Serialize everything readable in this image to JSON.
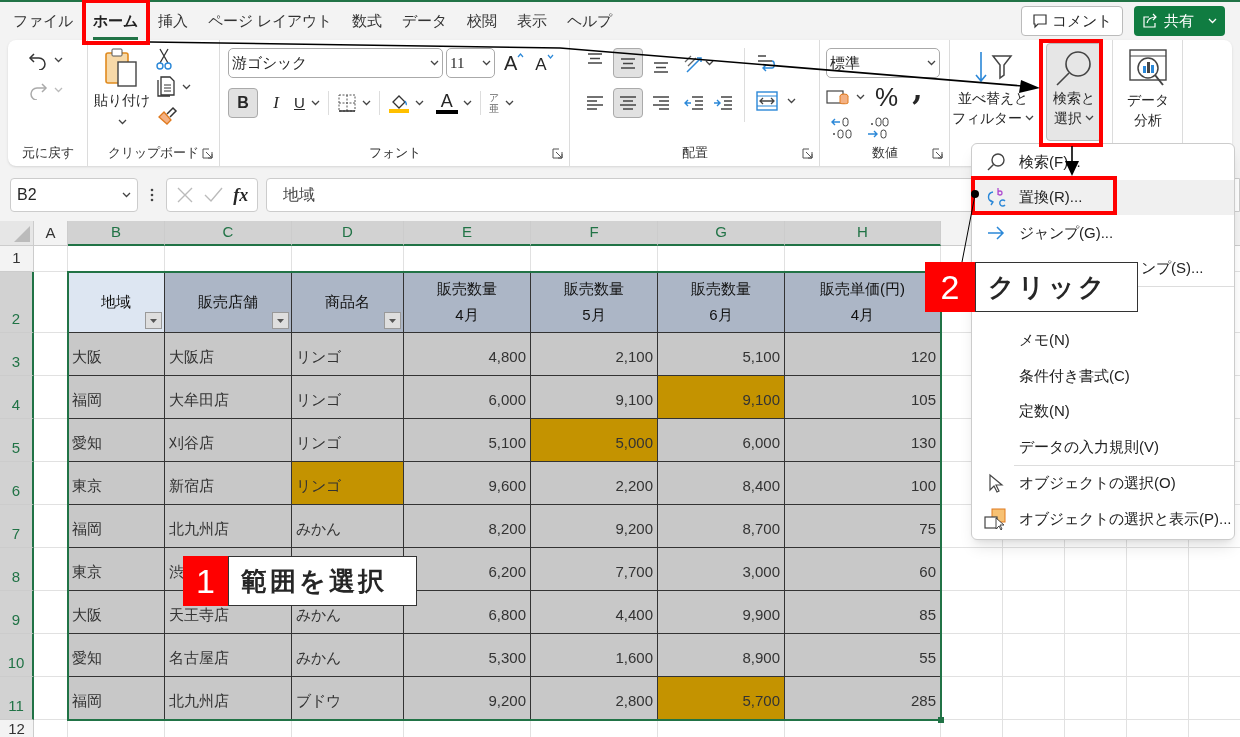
{
  "tabs": [
    {
      "label": "ファイル",
      "selected": false
    },
    {
      "label": "ホーム",
      "selected": true
    },
    {
      "label": "挿入",
      "selected": false
    },
    {
      "label": "ページ レイアウト",
      "selected": false
    },
    {
      "label": "数式",
      "selected": false
    },
    {
      "label": "データ",
      "selected": false
    },
    {
      "label": "校閲",
      "selected": false
    },
    {
      "label": "表示",
      "selected": false
    },
    {
      "label": "ヘルプ",
      "selected": false
    }
  ],
  "header_buttons": {
    "comment": "コメント",
    "share": "共有"
  },
  "ribbon": {
    "undo": {
      "label": "元に戻す"
    },
    "clipboard": {
      "paste": "貼り付け",
      "label": "クリップボード"
    },
    "font": {
      "name": "游ゴシック",
      "size": "11",
      "grow": "A",
      "shrink": "A",
      "bold": "B",
      "bold_on": true,
      "italic": "I",
      "underline": "U",
      "color_letter": "A",
      "furigana": [
        "ア",
        "亜"
      ],
      "label": "フォント"
    },
    "alignment": {
      "vertical": [
        {
          "selected": false
        },
        {
          "selected": true
        },
        {
          "selected": false
        }
      ],
      "horizontal": [
        {
          "selected": false
        },
        {
          "selected": true
        },
        {
          "selected": false
        }
      ],
      "label": "配置"
    },
    "number": {
      "format": "標準",
      "percent": "%",
      "comma": ",",
      "label": "数値"
    },
    "sort_filter": [
      "並べ替えと",
      "フィルター"
    ],
    "find_select": {
      "lines": [
        "検索と",
        "選択"
      ],
      "pressed": true
    },
    "data_analysis": [
      "データ",
      "分析"
    ]
  },
  "formula_bar": {
    "name_box": "B2",
    "function_label": "fx",
    "formula": "地域"
  },
  "sheet": {
    "columns": [
      {
        "label": "A",
        "selected": false
      },
      {
        "label": "B",
        "selected": true
      },
      {
        "label": "C",
        "selected": true
      },
      {
        "label": "D",
        "selected": true
      },
      {
        "label": "E",
        "selected": true
      },
      {
        "label": "F",
        "selected": true
      },
      {
        "label": "G",
        "selected": true
      },
      {
        "label": "H",
        "selected": true
      }
    ],
    "row_numbers": [
      {
        "label": "1",
        "selected": false
      },
      {
        "label": "2",
        "selected": true
      },
      {
        "label": "3",
        "selected": true
      },
      {
        "label": "4",
        "selected": true
      },
      {
        "label": "5",
        "selected": true
      },
      {
        "label": "6",
        "selected": true
      },
      {
        "label": "7",
        "selected": true
      },
      {
        "label": "8",
        "selected": true
      },
      {
        "label": "9",
        "selected": true
      },
      {
        "label": "10",
        "selected": true
      },
      {
        "label": "11",
        "selected": true
      },
      {
        "label": "12",
        "selected": false
      }
    ],
    "table": {
      "headers": [
        {
          "label": "地域",
          "filter": true,
          "active": true,
          "kind": "text"
        },
        {
          "label": "販売店舗",
          "filter": true,
          "active": false,
          "kind": "text"
        },
        {
          "label": "商品名",
          "filter": true,
          "active": false,
          "kind": "text"
        },
        {
          "label": "販売数量",
          "sub": "4月",
          "filter": false,
          "active": false,
          "kind": "number"
        },
        {
          "label": "販売数量",
          "sub": "5月",
          "filter": false,
          "active": false,
          "kind": "number"
        },
        {
          "label": "販売数量",
          "sub": "6月",
          "filter": false,
          "active": false,
          "kind": "number"
        },
        {
          "label": "販売単価(円)",
          "sub": "4月",
          "filter": false,
          "active": false,
          "kind": "number"
        }
      ],
      "rows": [
        {
          "cells": [
            "大阪",
            "大阪店",
            "リンゴ",
            "4,800",
            "2,100",
            "5,100",
            "120"
          ],
          "highlight": [
            false,
            false,
            false,
            false,
            false,
            false,
            false
          ]
        },
        {
          "cells": [
            "福岡",
            "大牟田店",
            "リンゴ",
            "6,000",
            "9,100",
            "9,100",
            "105"
          ],
          "highlight": [
            false,
            false,
            false,
            false,
            false,
            true,
            false
          ]
        },
        {
          "cells": [
            "愛知",
            "刈谷店",
            "リンゴ",
            "5,100",
            "5,000",
            "6,000",
            "130"
          ],
          "highlight": [
            false,
            false,
            false,
            false,
            true,
            false,
            false
          ]
        },
        {
          "cells": [
            "東京",
            "新宿店",
            "リンゴ",
            "9,600",
            "2,200",
            "8,400",
            "100"
          ],
          "highlight": [
            false,
            false,
            true,
            false,
            false,
            false,
            false
          ]
        },
        {
          "cells": [
            "福岡",
            "北九州店",
            "みかん",
            "8,200",
            "9,200",
            "8,700",
            "75"
          ],
          "highlight": [
            false,
            false,
            false,
            false,
            false,
            false,
            false
          ]
        },
        {
          "cells": [
            "東京",
            "渋",
            "",
            "6,200",
            "7,700",
            "3,000",
            "60"
          ],
          "highlight": [
            false,
            false,
            false,
            false,
            false,
            false,
            false
          ]
        },
        {
          "cells": [
            "大阪",
            "天王寺店",
            "みかん",
            "6,800",
            "4,400",
            "9,900",
            "85"
          ],
          "highlight": [
            false,
            false,
            false,
            false,
            false,
            false,
            false
          ]
        },
        {
          "cells": [
            "愛知",
            "名古屋店",
            "みかん",
            "5,300",
            "1,600",
            "8,900",
            "55"
          ],
          "highlight": [
            false,
            false,
            false,
            false,
            false,
            false,
            false
          ]
        },
        {
          "cells": [
            "福岡",
            "北九州店",
            "ブドウ",
            "9,200",
            "2,800",
            "5,700",
            "285"
          ],
          "highlight": [
            false,
            false,
            false,
            false,
            false,
            true,
            false
          ]
        }
      ]
    }
  },
  "menu": {
    "items": [
      {
        "kind": "search",
        "label": "検索(F)...",
        "selected": false
      },
      {
        "kind": "replace",
        "label": "置換(R)...",
        "selected": true
      },
      {
        "kind": "goto",
        "label": "ジャンプ(G)...",
        "selected": false
      },
      {
        "kind": "partial",
        "label": "ンプ(S)...",
        "selected": false
      },
      {
        "kind": "separator"
      },
      {
        "kind": "plain",
        "label": "メモ(N)",
        "selected": false
      },
      {
        "kind": "plain",
        "label": "条件付き書式(C)",
        "selected": false
      },
      {
        "kind": "plain",
        "label": "定数(N)",
        "selected": false
      },
      {
        "kind": "plain",
        "label": "データの入力規則(V)",
        "selected": false
      },
      {
        "kind": "separator"
      },
      {
        "kind": "pointer",
        "label": "オブジェクトの選択(O)",
        "selected": false
      },
      {
        "kind": "objects",
        "label": "オブジェクトの選択と表示(P)...",
        "selected": false
      }
    ]
  },
  "callouts": [
    {
      "number": "1",
      "text": "範囲を選択"
    },
    {
      "number": "2",
      "text": "クリック"
    }
  ]
}
